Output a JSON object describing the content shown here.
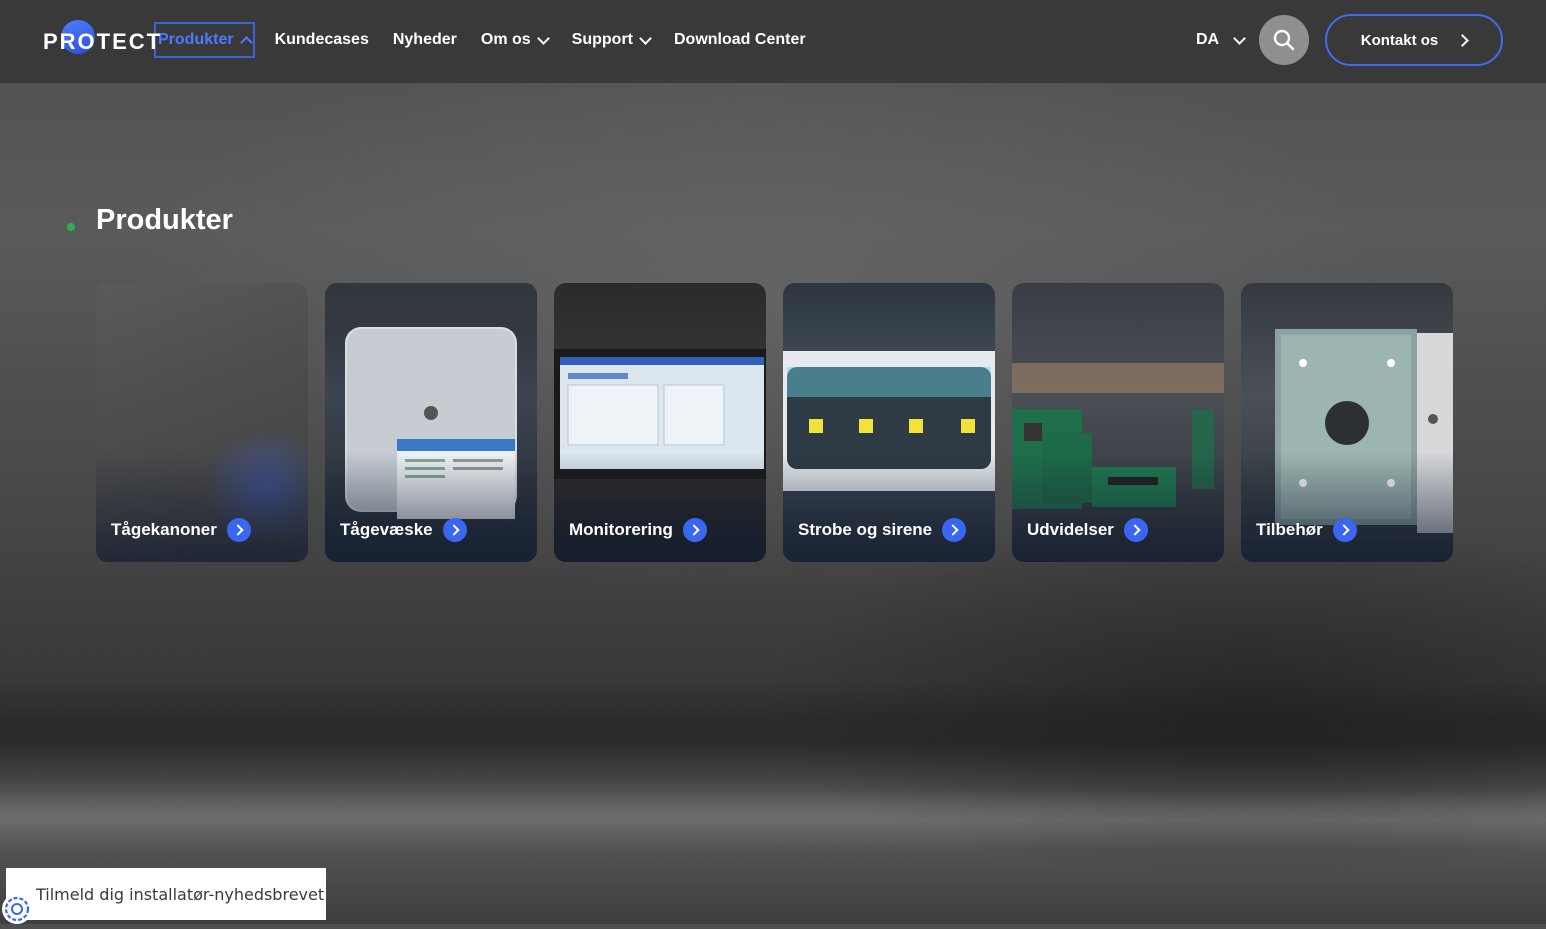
{
  "header": {
    "logo_text": "PROTECT",
    "nav": [
      {
        "label": "Produkter",
        "state": "expanded"
      },
      {
        "label": "Kundecases"
      },
      {
        "label": "Nyheder"
      },
      {
        "label": "Om os",
        "dropdown": true
      },
      {
        "label": "Support",
        "dropdown": true
      },
      {
        "label": "Download Center"
      }
    ],
    "language": "DA",
    "contact_label": "Kontakt os"
  },
  "section": {
    "title": "Produkter"
  },
  "cards": [
    {
      "label": "Tågekanoner"
    },
    {
      "label": "Tågevæske"
    },
    {
      "label": "Monitorering"
    },
    {
      "label": "Strobe og sirene"
    },
    {
      "label": "Udvidelser"
    },
    {
      "label": "Tilbehør"
    }
  ],
  "newsletter": {
    "label": "Tilmeld dig installatør-nyhedsbrevet"
  },
  "colors": {
    "accent": "#3b66f0",
    "active_nav": "#4a7bff",
    "status_dot": "#2bb24c",
    "header_bg": "#373737"
  }
}
